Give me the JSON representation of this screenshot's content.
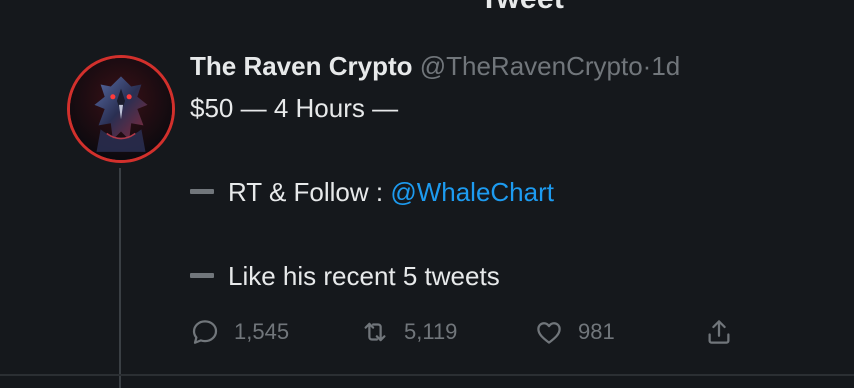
{
  "header": {
    "title": "Tweet"
  },
  "tweet": {
    "display_name": "The Raven Crypto",
    "handle": "@TheRavenCrypto",
    "separator": "·",
    "time": "1d",
    "line1": "$50 — 4 Hours —",
    "line2_prefix": "RT & Follow : ",
    "line2_mention": "@WhaleChart",
    "line3": "Like his recent 5 tweets"
  },
  "actions": {
    "replies": "1,545",
    "retweets": "5,119",
    "likes": "981"
  },
  "icons": {
    "reply": "reply-icon",
    "retweet": "retweet-icon",
    "like": "heart-icon",
    "share": "share-icon"
  },
  "colors": {
    "background": "#15181c",
    "text": "#e7e9ea",
    "muted": "#71767b",
    "link": "#1d9bf0",
    "avatar_ring": "#d2302c"
  }
}
